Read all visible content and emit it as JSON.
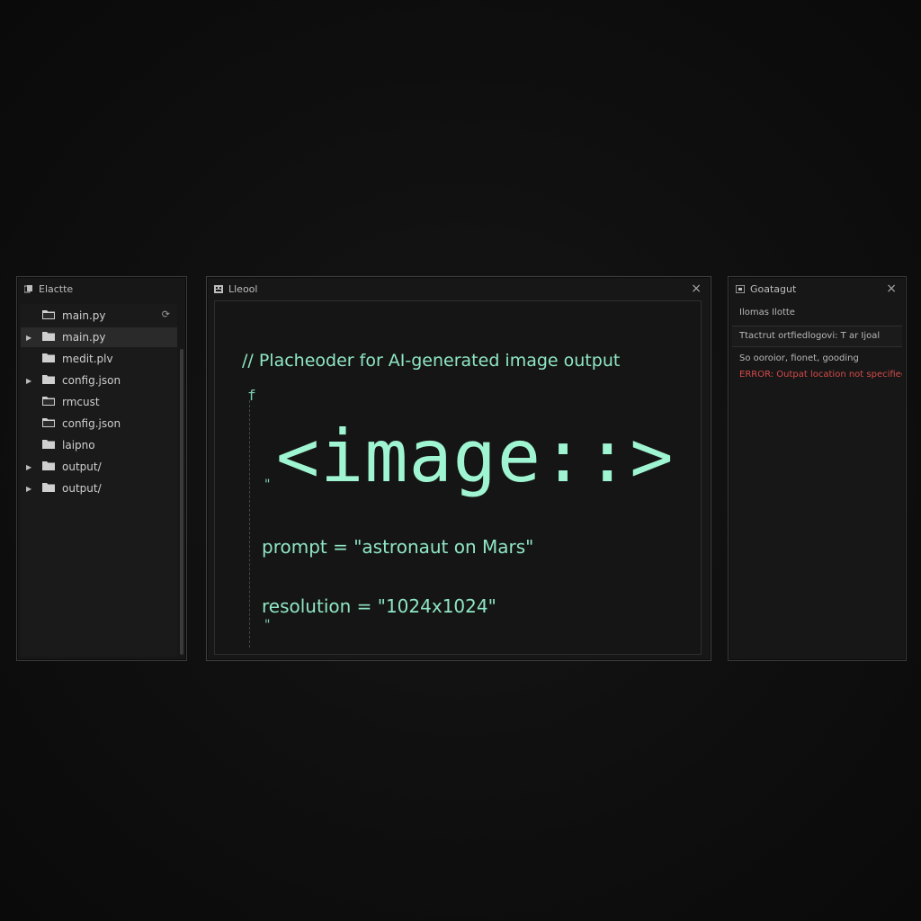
{
  "explorer": {
    "title": "Elactte",
    "items": [
      {
        "label": "main.py",
        "caret": false
      },
      {
        "label": "main.py",
        "caret": true,
        "selected": true
      },
      {
        "label": "medit.plv",
        "caret": false
      },
      {
        "label": "config.json",
        "caret": true
      },
      {
        "label": "rmcust",
        "caret": false
      },
      {
        "label": "config.json",
        "caret": false
      },
      {
        "label": "laipno",
        "caret": false
      },
      {
        "label": "output/",
        "caret": true
      },
      {
        "label": "output/",
        "caret": true
      }
    ],
    "refresh_glyph": "⟳"
  },
  "editor": {
    "title": "Lleool",
    "close_glyph": "×",
    "lines": {
      "comment": "// Placheoder for AI-generated image output",
      "brace": "f",
      "big": "<image::>",
      "quote1": "\"",
      "prompt": "prompt = \"astronaut on Mars\"",
      "resolution": "resolution = \"1024x1024\"",
      "quote2": "\""
    }
  },
  "output": {
    "title": "Goatagut",
    "close_glyph": "×",
    "lines": [
      "Ilomas Ilotte",
      "Ttactrut ortfiedlogovi: T ar Ijoal",
      "So ooroior, fionet, gooding",
      "ERROR: Outpat location not specified"
    ]
  },
  "colors": {
    "code": "#8fe6c4",
    "error": "#d64a4a",
    "background": "#0e0e0e"
  }
}
